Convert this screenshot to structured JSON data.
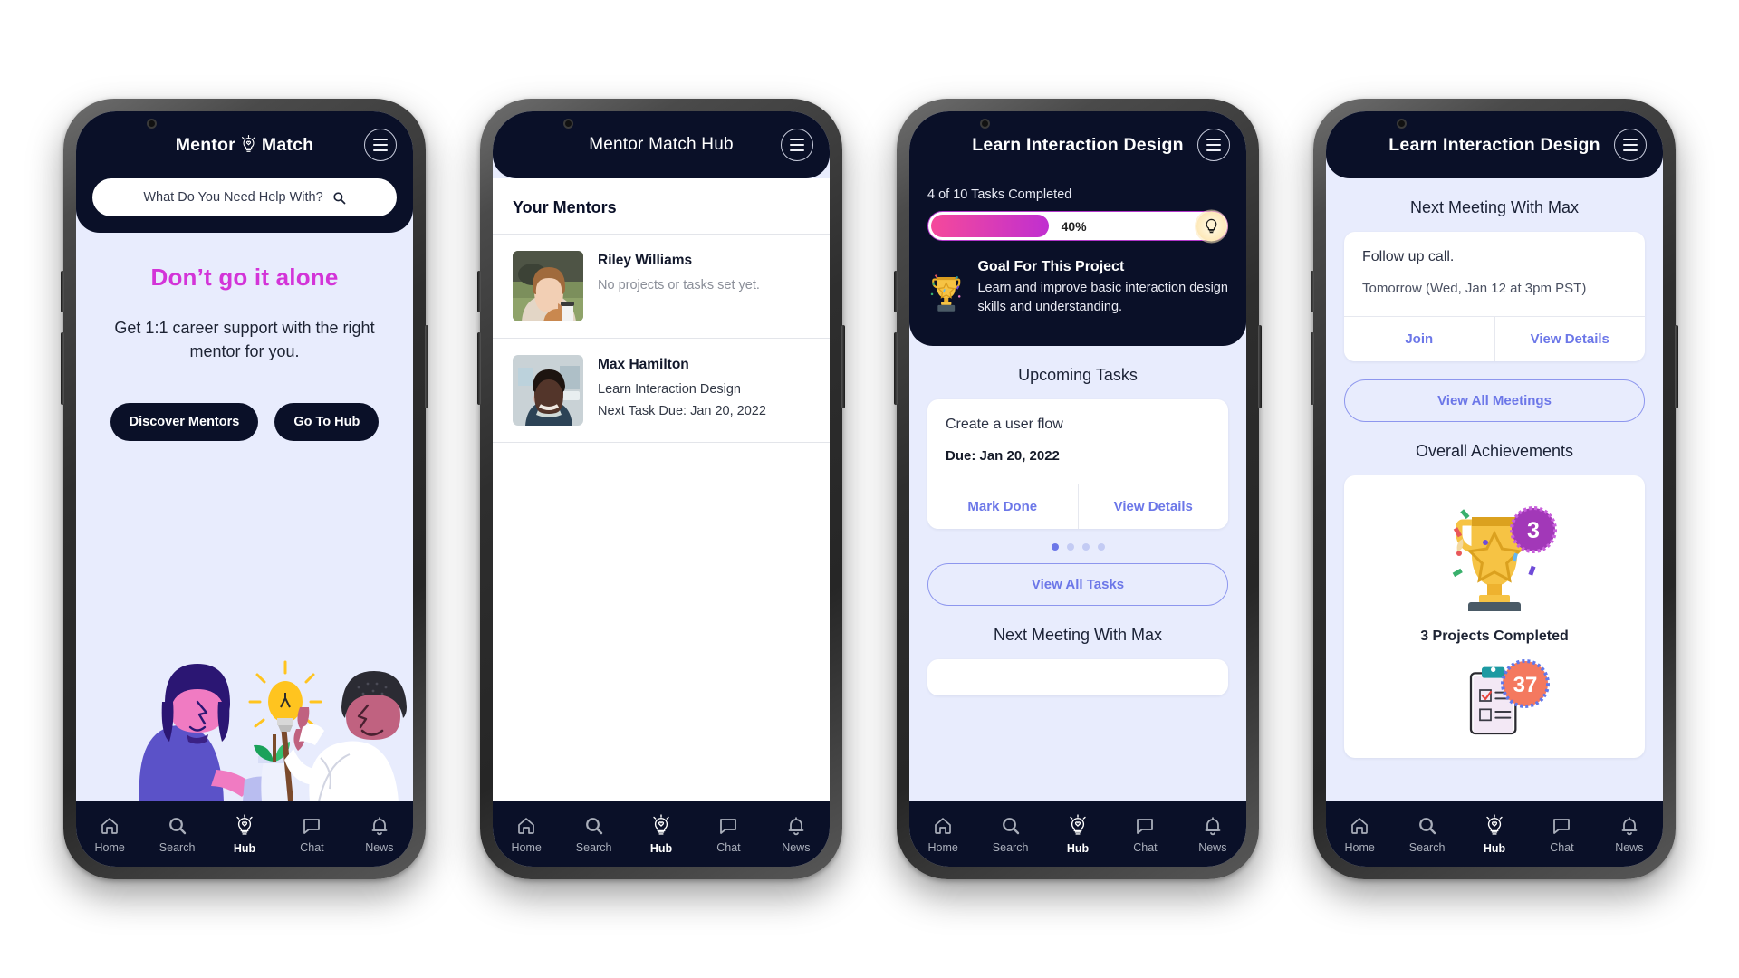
{
  "nav": {
    "items": [
      {
        "label": "Home",
        "icon": "home-icon",
        "active": false
      },
      {
        "label": "Search",
        "icon": "search-icon",
        "active": false
      },
      {
        "label": "Hub",
        "icon": "bulb-icon",
        "active": true
      },
      {
        "label": "Chat",
        "icon": "chat-icon",
        "active": false
      },
      {
        "label": "News",
        "icon": "bell-icon",
        "active": false
      }
    ]
  },
  "colors": {
    "dark_navy": "#0a1028",
    "lavender_bg": "#e8ecfd",
    "magenta": "#d334d8",
    "periwinkle": "#6c77e8",
    "progress_start": "#f5499b",
    "progress_end": "#c02fd0"
  },
  "menu_icon": "hamburger-menu-icon",
  "screen1": {
    "title_left": "Mentor",
    "title_right": "Match",
    "logo_icon": "lightbulb-heart-icon",
    "search": {
      "placeholder": "What Do You Need Help With?",
      "value": "",
      "icon": "search-icon"
    },
    "headline": "Don’t go it alone",
    "subhead": "Get 1:1 career support with the right mentor for you.",
    "buttons": {
      "primary": "Discover Mentors",
      "secondary": "Go To Hub"
    },
    "illustration": "two-people-with-lightbulb-and-plant-illustration"
  },
  "screen2": {
    "title": "Mentor Match Hub",
    "section_title": "Your Mentors",
    "mentors": [
      {
        "name": "Riley Williams",
        "line1": "No projects or tasks set yet.",
        "line2": "",
        "muted": true,
        "avatar": "photo-woman-with-coffee"
      },
      {
        "name": "Max Hamilton",
        "line1": "Learn Interaction Design",
        "line2": "Next Task Due: Jan 20, 2022",
        "muted": false,
        "avatar": "photo-man-in-blazer"
      }
    ]
  },
  "screen3": {
    "title": "Learn Interaction Design",
    "tasks_completed": "4 of 10 Tasks Completed",
    "progress_label": "40%",
    "progress_percent": 40,
    "progress_knob_icon": "lightbulb-icon",
    "goal": {
      "icon": "trophy-icon",
      "heading": "Goal For This Project",
      "text": "Learn and improve basic interaction design skills and understanding."
    },
    "upcoming_heading": "Upcoming Tasks",
    "task_card": {
      "title": "Create a user flow",
      "due": "Due: Jan 20, 2022",
      "action_left": "Mark Done",
      "action_right": "View Details"
    },
    "carousel_dots": 4,
    "carousel_active": 0,
    "view_all_tasks": "View All Tasks",
    "next_meeting_heading": "Next Meeting With Max"
  },
  "screen4": {
    "title": "Learn Interaction Design",
    "meeting_heading": "Next Meeting With Max",
    "meeting_card": {
      "title": "Follow up call.",
      "when": "Tomorrow (Wed, Jan 12 at 3pm PST)",
      "action_left": "Join",
      "action_right": "View Details"
    },
    "view_all_meetings": "View All Meetings",
    "achievements_heading": "Overall Achievements",
    "achievements": [
      {
        "icon": "trophy-icon",
        "badge": "3",
        "label": "3 Projects Completed",
        "badge_color": "#a238b8"
      },
      {
        "icon": "clipboard-icon",
        "badge": "37",
        "label": "",
        "badge_color": "#f4795f"
      }
    ]
  }
}
